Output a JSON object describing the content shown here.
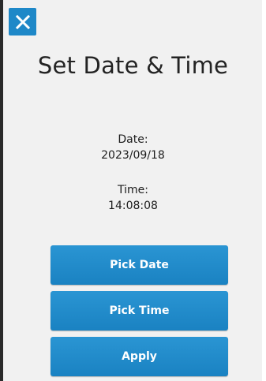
{
  "dialog": {
    "title": "Set Date & Time",
    "close_icon": "close-icon"
  },
  "date": {
    "label": "Date:",
    "value": "2023/09/18"
  },
  "time": {
    "label": "Time:",
    "value": "14:08:08"
  },
  "buttons": {
    "pick_date": "Pick Date",
    "pick_time": "Pick Time",
    "apply": "Apply"
  },
  "colors": {
    "accent": "#1e88c8",
    "background": "#f1f1f1",
    "button_text": "#ffffff"
  }
}
